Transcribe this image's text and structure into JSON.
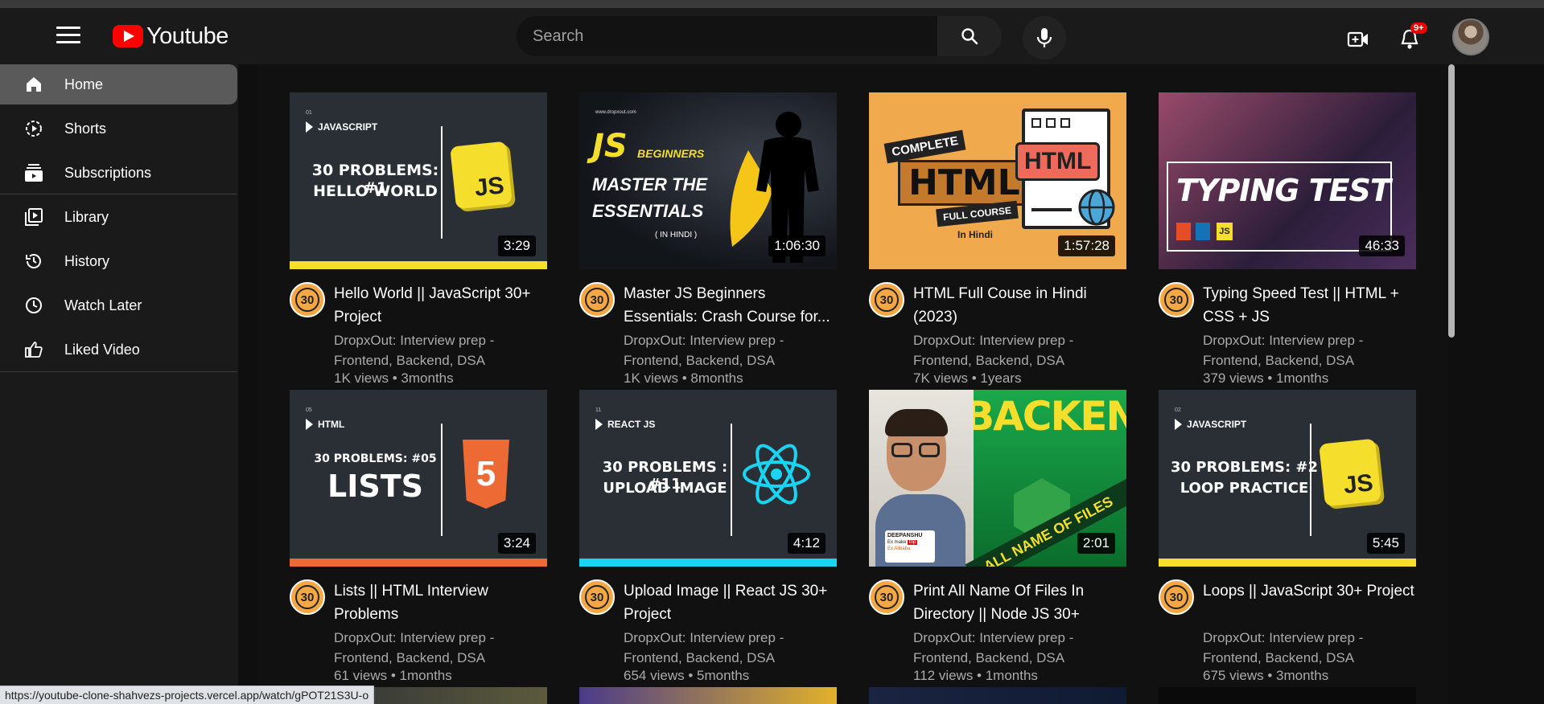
{
  "header": {
    "logo_text": "Youtube",
    "search_placeholder": "Search",
    "notification_count": "9+"
  },
  "sidebar": {
    "items": [
      {
        "label": "Home",
        "icon": "home-icon",
        "active": true
      },
      {
        "label": "Shorts",
        "icon": "shorts-icon"
      },
      {
        "label": "Subscriptions",
        "icon": "subscriptions-icon"
      },
      {
        "label": "Library",
        "icon": "library-icon"
      },
      {
        "label": "History",
        "icon": "history-icon"
      },
      {
        "label": "Watch Later",
        "icon": "clock-icon"
      },
      {
        "label": "Liked Video",
        "icon": "thumbs-up-icon"
      }
    ]
  },
  "videos": [
    {
      "title": "Hello World || JavaScript 30+ Project",
      "channel": "DropxOut: Interview prep - Frontend, Backend, DSA",
      "meta": "1K views • 3months",
      "duration": "3:29",
      "thumb": {
        "num": "01",
        "tag": "JAVASCRIPT",
        "line1": "30 PROBLEMS: #1",
        "line2": "HELLO WORLD",
        "logo": "JS"
      }
    },
    {
      "title": "Master JS Beginners Essentials: Crash Course for...",
      "channel": "DropxOut: Interview prep - Frontend, Backend, DSA",
      "meta": "1K views • 8months",
      "duration": "1:06:30",
      "thumb": {
        "site": "www.dropxout.com",
        "js": "JS",
        "beginners": "BEGINNERS",
        "line1": "MASTER THE",
        "line2": "ESSENTIALS",
        "line3": "( IN HINDI )"
      }
    },
    {
      "title": "HTML Full Couse in Hindi (2023)",
      "channel": "DropxOut: Interview prep - Frontend, Backend, DSA",
      "meta": "7K views • 1years",
      "duration": "1:57:28",
      "thumb": {
        "complete": "COMPLETE",
        "html": "HTML",
        "full": "FULL COURSE",
        "hindi": "In Hindi",
        "badge": "HTML"
      }
    },
    {
      "title": "Typing Speed Test || HTML + CSS + JS",
      "channel": "DropxOut: Interview prep - Frontend, Backend, DSA",
      "meta": "379 views • 1months",
      "duration": "46:33",
      "thumb": {
        "text": "TYPING TEST",
        "js": "JS"
      }
    },
    {
      "title": "Lists || HTML Interview Problems",
      "channel": "DropxOut: Interview prep - Frontend, Backend, DSA",
      "meta": "61 views • 1months",
      "duration": "3:24",
      "thumb": {
        "num": "05",
        "tag": "HTML",
        "line1": "30 PROBLEMS: #05",
        "line2": "LISTS",
        "logo": "5"
      }
    },
    {
      "title": "Upload Image || React JS 30+ Project",
      "channel": "DropxOut: Interview prep - Frontend, Backend, DSA",
      "meta": "654 views • 5months",
      "duration": "4:12",
      "thumb": {
        "num": "11",
        "tag": "REACT JS",
        "line1": "30 PROBLEMS : #11",
        "line2": "UPLOAD IMAGE"
      }
    },
    {
      "title": "Print All Name Of Files In Directory || Node JS 30+",
      "channel": "DropxOut: Interview prep - Frontend, Backend, DSA",
      "meta": "112 views • 1months",
      "duration": "2:01",
      "thumb": {
        "backend": "BACKEND",
        "band": "ALL NAME OF FILES",
        "name": "DEEPANSHU",
        "sub1": "Ex make",
        "sub2": "trip",
        "sub3": "Ex Alibaba"
      }
    },
    {
      "title": "Loops || JavaScript 30+ Project",
      "channel": "DropxOut: Interview prep - Frontend, Backend, DSA",
      "meta": "675 views • 3months",
      "duration": "5:45",
      "thumb": {
        "num": "02",
        "tag": "JAVASCRIPT",
        "line1": "30 PROBLEMS: #2",
        "line2": "LOOP PRACTICE",
        "logo": "JS"
      }
    }
  ],
  "channel_avatar_text": "30",
  "status_url": "https://youtube-clone-shahvezs-projects.vercel.app/watch/gPOT21S3U-o",
  "colors": {
    "accent_red": "#ff0000",
    "js_yellow": "#f5df2c",
    "html_orange": "#ee6a34",
    "react_blue": "#19d4f2"
  }
}
